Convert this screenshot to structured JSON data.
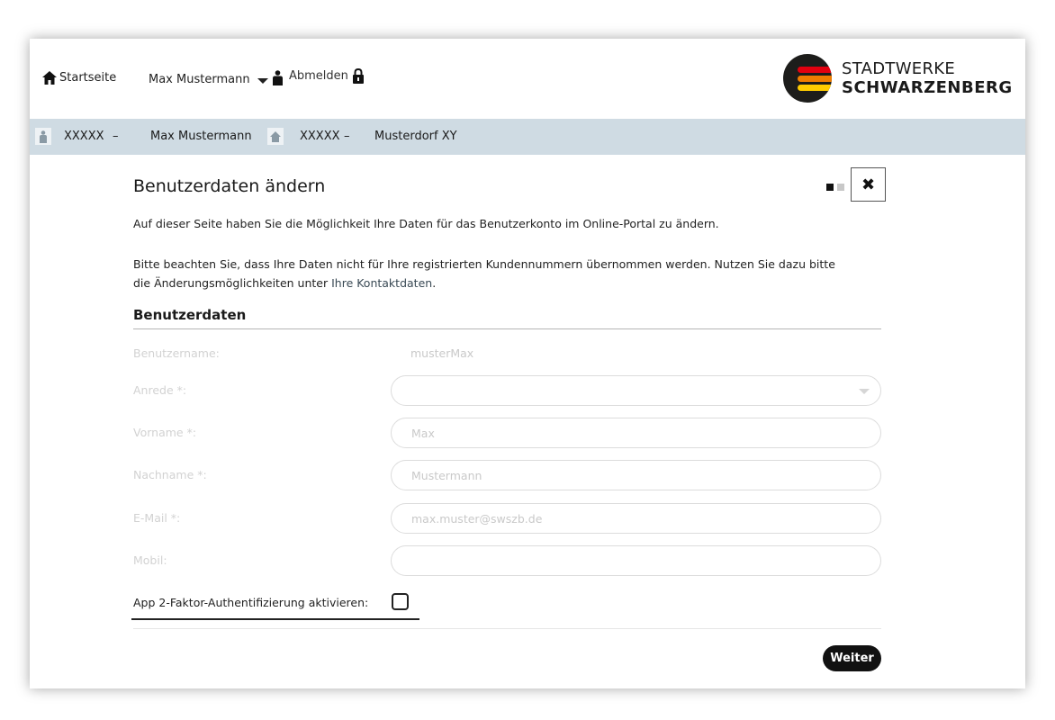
{
  "header": {
    "home_label": "Startseite",
    "user_name": "Max Mustermann",
    "logout_label": "Abmelden",
    "logo": {
      "line1": "STADTWERKE",
      "line2": "SCHWARZENBERG",
      "colors": [
        "#e3000f",
        "#f07d00",
        "#ffcc00"
      ],
      "mark_color": "#1d1d1b"
    }
  },
  "infobar": {
    "customer_number": "XXXXX",
    "separator": "–",
    "customer_name": "Max Mustermann",
    "meter_number": "XXXXX",
    "location": "Musterdorf XY",
    "background": "#cfdbe3"
  },
  "main": {
    "title": "Benutzerdaten ändern",
    "pager": {
      "active_color": "#111111",
      "inactive_color": "#c8c8c8"
    },
    "close_icon": "✖",
    "intro": "Auf dieser Seite haben Sie die Möglichkeit Ihre Daten für das Benutzerkonto im Online-Portal zu ändern.",
    "notice_text": "Bitte beachten Sie, dass Ihre Daten nicht für Ihre registrierten Kundennummern übernommen werden. Nutzen Sie dazu bitte die Änderungsmöglichkeiten unter ",
    "notice_link": "Ihre Kontaktdaten",
    "notice_end": ".",
    "section_title": "Benutzerdaten",
    "form": {
      "username_label": "Benutzername:",
      "username_value": "musterMax",
      "salutation_label": "Anrede *:",
      "salutation_value": "",
      "firstname_label": "Vorname *:",
      "firstname_value": "Max",
      "lastname_label": "Nachname *:",
      "lastname_value": "Mustermann",
      "email_label": "E-Mail *:",
      "email_value": "max.muster@swszb.de",
      "mobile_label": "Mobil:",
      "mobile_value": ""
    },
    "tfa_label": "App 2-Faktor-Authentifizierung aktivieren:",
    "next_label": "Weiter"
  }
}
